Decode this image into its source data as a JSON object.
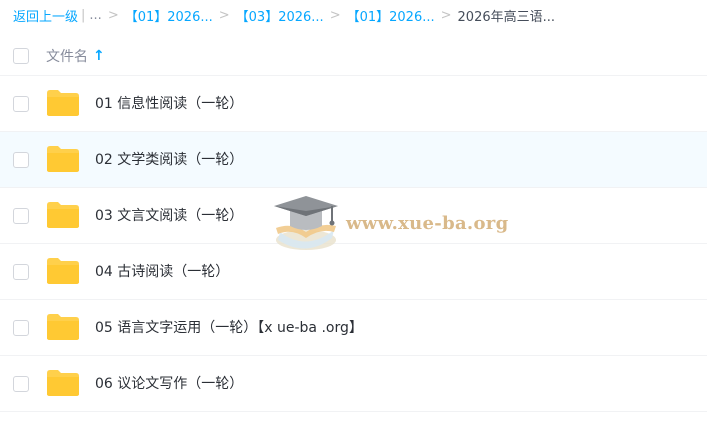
{
  "breadcrumb": {
    "back": "返回上一级",
    "ellipsis": "...",
    "items": [
      "【01】2026...",
      "【03】2026...",
      "【01】2026..."
    ],
    "current": "2026年高三语..."
  },
  "header": {
    "column_label": "文件名",
    "sort_icon": "arrow-up-icon"
  },
  "files": [
    {
      "name": "01 信息性阅读（一轮）",
      "icon": "folder-icon"
    },
    {
      "name": "02 文学类阅读（一轮）",
      "icon": "folder-icon"
    },
    {
      "name": "03 文言文阅读（一轮）",
      "icon": "folder-icon"
    },
    {
      "name": "04 古诗阅读（一轮）",
      "icon": "folder-icon"
    },
    {
      "name": "05 语言文字运用（一轮）【x ue-ba .org】",
      "icon": "folder-icon"
    },
    {
      "name": "06 议论文写作（一轮）",
      "icon": "folder-icon"
    }
  ],
  "watermark": {
    "text": "www.xue-ba.org",
    "icon": "graduation-cap-icon"
  },
  "colors": {
    "accent": "#06a7ff",
    "folder": "#ffd04b",
    "row_hover": "#f4fbff",
    "divider": "#f1f2f4"
  }
}
